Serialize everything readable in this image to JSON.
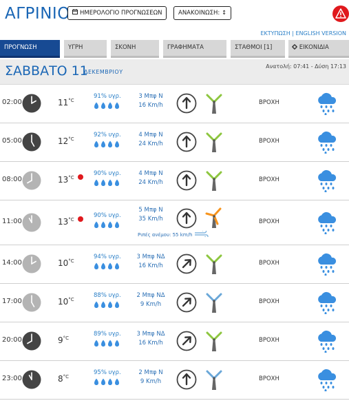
{
  "header": {
    "city": "ΑΓΡΙΝΙΟ",
    "calendar_button": "ΗΜΕΡΟΛΟΓΙΟ ΠΡΟΓΝΩΣΕΩΝ",
    "announcements_button": "ΑΝΑΚΟΙΝΩΣΗ:",
    "announcements_icon": "↕",
    "print_link": "ΕΚΤΥΠΩΣΗ | ENGLISH VERSION"
  },
  "tabs": [
    {
      "label": "ΠΡΟΓΝΩΣΗ",
      "active": true
    },
    {
      "label": "ΥΓΡΗ",
      "active": false
    },
    {
      "label": "ΣΚΟΝΗ",
      "active": false
    },
    {
      "label": "ΓΡΑΦΗΜΑΤΑ",
      "active": false
    },
    {
      "label": "ΣΤΑΘΜΟΙ [1]",
      "active": false
    },
    {
      "label": "ΕΙΚΟΝΙΔΙΑ",
      "active": false
    }
  ],
  "day": {
    "name": "ΣΑΒΒΑΤΟ 11",
    "month": "ΔΕΚΕΜΒΡΙΟΥ",
    "sun": "Ανατολή: 07:41 - Δύση 17:13"
  },
  "rows": [
    {
      "time": "02:00",
      "temp": "11",
      "unit": "°C",
      "hum": "91% υγρ.",
      "wind": "3 Μπφ Ν",
      "speed": "16 Km/h",
      "cond": "ΒΡΟΧΗ",
      "night": true,
      "warn": false,
      "dir": 0,
      "turbine": "green"
    },
    {
      "time": "05:00",
      "temp": "12",
      "unit": "°C",
      "hum": "92% υγρ.",
      "wind": "4 Μπφ Ν",
      "speed": "24 Km/h",
      "cond": "ΒΡΟΧΗ",
      "night": true,
      "warn": false,
      "dir": 0,
      "turbine": "green"
    },
    {
      "time": "08:00",
      "temp": "13",
      "unit": "°C",
      "hum": "90% υγρ.",
      "wind": "4 Μπφ Ν",
      "speed": "24 Km/h",
      "cond": "ΒΡΟΧΗ",
      "night": false,
      "warn": true,
      "dir": 0,
      "turbine": "green"
    },
    {
      "time": "11:00",
      "temp": "13",
      "unit": "°C",
      "hum": "90% υγρ.",
      "wind": "5 Μπφ Ν",
      "speed": "35 Km/h",
      "cond": "ΒΡΟΧΗ",
      "night": false,
      "warn": true,
      "dir": 0,
      "turbine": "orange",
      "gust": "Ριπές ανέμου: 55 km/h"
    },
    {
      "time": "14:00",
      "temp": "10",
      "unit": "°C",
      "hum": "94% υγρ.",
      "wind": "3 Μπφ ΝΔ",
      "speed": "16 Km/h",
      "cond": "ΒΡΟΧΗ",
      "night": false,
      "warn": false,
      "dir": 45,
      "turbine": "green"
    },
    {
      "time": "17:00",
      "temp": "10",
      "unit": "°C",
      "hum": "88% υγρ.",
      "wind": "2 Μπφ ΝΔ",
      "speed": "9 Km/h",
      "cond": "ΒΡΟΧΗ",
      "night": false,
      "warn": false,
      "dir": 45,
      "turbine": "blue"
    },
    {
      "time": "20:00",
      "temp": "9",
      "unit": "°C",
      "hum": "89% υγρ.",
      "wind": "3 Μπφ ΝΔ",
      "speed": "16 Km/h",
      "cond": "ΒΡΟΧΗ",
      "night": true,
      "warn": false,
      "dir": 45,
      "turbine": "green"
    },
    {
      "time": "23:00",
      "temp": "8",
      "unit": "°C",
      "hum": "95% υγρ.",
      "wind": "2 Μπφ Ν",
      "speed": "9 Km/h",
      "cond": "ΒΡΟΧΗ",
      "night": true,
      "warn": false,
      "dir": 0,
      "turbine": "blue"
    }
  ],
  "colors": {
    "accent": "#1a66b5",
    "tab_active": "#174a93",
    "night_clock": "#444444",
    "day_clock": "#b4b4b4",
    "rain": "#3a8fe0",
    "turbine_green": "#8dc63f",
    "turbine_orange": "#f7941d",
    "turbine_blue": "#6aa7d8",
    "alert": "#e0191d"
  }
}
